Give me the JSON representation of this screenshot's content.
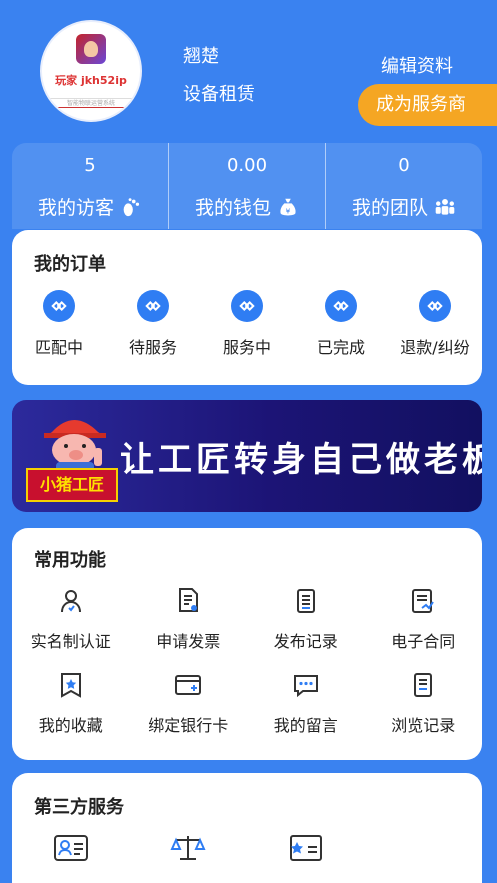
{
  "profile": {
    "avatar_text": "玩家 jkh52ip",
    "avatar_subtext": "智能物联运营系统",
    "name": "翘楚",
    "role": "设备租赁",
    "edit_label": "编辑资料",
    "become_provider_label": "成为服务商"
  },
  "stats": [
    {
      "value": "5",
      "label": "我的访客",
      "icon": "footprint-icon"
    },
    {
      "value": "0.00",
      "label": "我的钱包",
      "icon": "money-bag-icon"
    },
    {
      "value": "0",
      "label": "我的团队",
      "icon": "team-icon"
    }
  ],
  "orders": {
    "title": "我的订单",
    "items": [
      {
        "label": "匹配中"
      },
      {
        "label": "待服务"
      },
      {
        "label": "服务中"
      },
      {
        "label": "已完成"
      },
      {
        "label": "退款/纠纷"
      }
    ]
  },
  "banner": {
    "slogan": "让工匠转身自己做老板",
    "brand": "小猪工匠"
  },
  "functions": {
    "title": "常用功能",
    "items": [
      {
        "label": "实名制认证",
        "icon": "user-verify-icon"
      },
      {
        "label": "申请发票",
        "icon": "invoice-icon"
      },
      {
        "label": "发布记录",
        "icon": "document-icon"
      },
      {
        "label": "电子合同",
        "icon": "contract-icon"
      },
      {
        "label": "我的收藏",
        "icon": "star-bookmark-icon"
      },
      {
        "label": "绑定银行卡",
        "icon": "bank-card-icon"
      },
      {
        "label": "我的留言",
        "icon": "message-icon"
      },
      {
        "label": "浏览记录",
        "icon": "history-icon"
      }
    ]
  },
  "third_party": {
    "title": "第三方服务",
    "items": [
      {
        "icon": "id-card-icon"
      },
      {
        "icon": "scales-icon"
      },
      {
        "icon": "certificate-icon"
      }
    ]
  },
  "colors": {
    "background": "#3a82f0",
    "accent": "#2f7df3",
    "orange": "#f5a623"
  }
}
